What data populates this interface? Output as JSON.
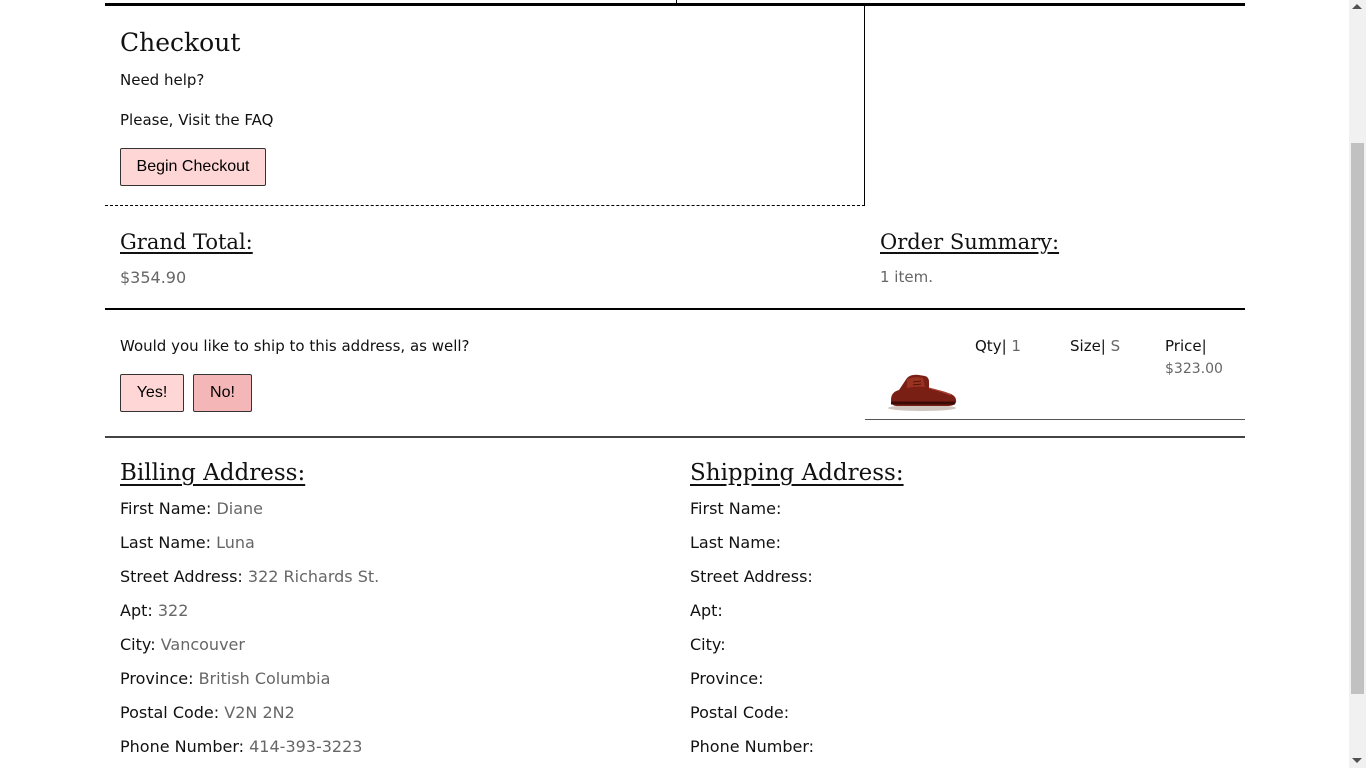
{
  "checkout": {
    "title": "Checkout",
    "help": "Need help?",
    "faq": "Please, Visit the FAQ",
    "begin_label": "Begin Checkout"
  },
  "totals": {
    "grand_label": "Grand Total:",
    "grand_value": "$354.90",
    "order_label": "Order Summary:",
    "order_items": "1 item."
  },
  "ship_prompt": {
    "question": "Would you like to ship to this address, as well?",
    "yes_label": "Yes!",
    "no_label": "No!"
  },
  "product": {
    "image_icon": "shoe-product-image",
    "qty_label": "Qty|",
    "qty_value": "1",
    "size_label": "Size|",
    "size_value": "S",
    "price_label": "Price|",
    "price_value": "$323.00"
  },
  "billing": {
    "title": "Billing Address:",
    "fields": [
      {
        "label": "First Name:",
        "value": "Diane"
      },
      {
        "label": "Last Name:",
        "value": "Luna"
      },
      {
        "label": "Street Address:",
        "value": "322 Richards St."
      },
      {
        "label": "Apt:",
        "value": "322"
      },
      {
        "label": "City:",
        "value": "Vancouver"
      },
      {
        "label": "Province:",
        "value": "British Columbia"
      },
      {
        "label": "Postal Code:",
        "value": "V2N 2N2"
      },
      {
        "label": "Phone Number:",
        "value": "414-393-3223"
      }
    ]
  },
  "shipping": {
    "title": "Shipping Address:",
    "fields": [
      {
        "label": "First Name:",
        "value": ""
      },
      {
        "label": "Last Name:",
        "value": ""
      },
      {
        "label": "Street Address:",
        "value": ""
      },
      {
        "label": "Apt:",
        "value": ""
      },
      {
        "label": "City:",
        "value": ""
      },
      {
        "label": "Province:",
        "value": ""
      },
      {
        "label": "Postal Code:",
        "value": ""
      },
      {
        "label": "Phone Number:",
        "value": ""
      }
    ]
  },
  "colors": {
    "button_bg": "#ffd6d6",
    "button_active_bg": "#f4b6b6",
    "value_text": "#666666"
  }
}
